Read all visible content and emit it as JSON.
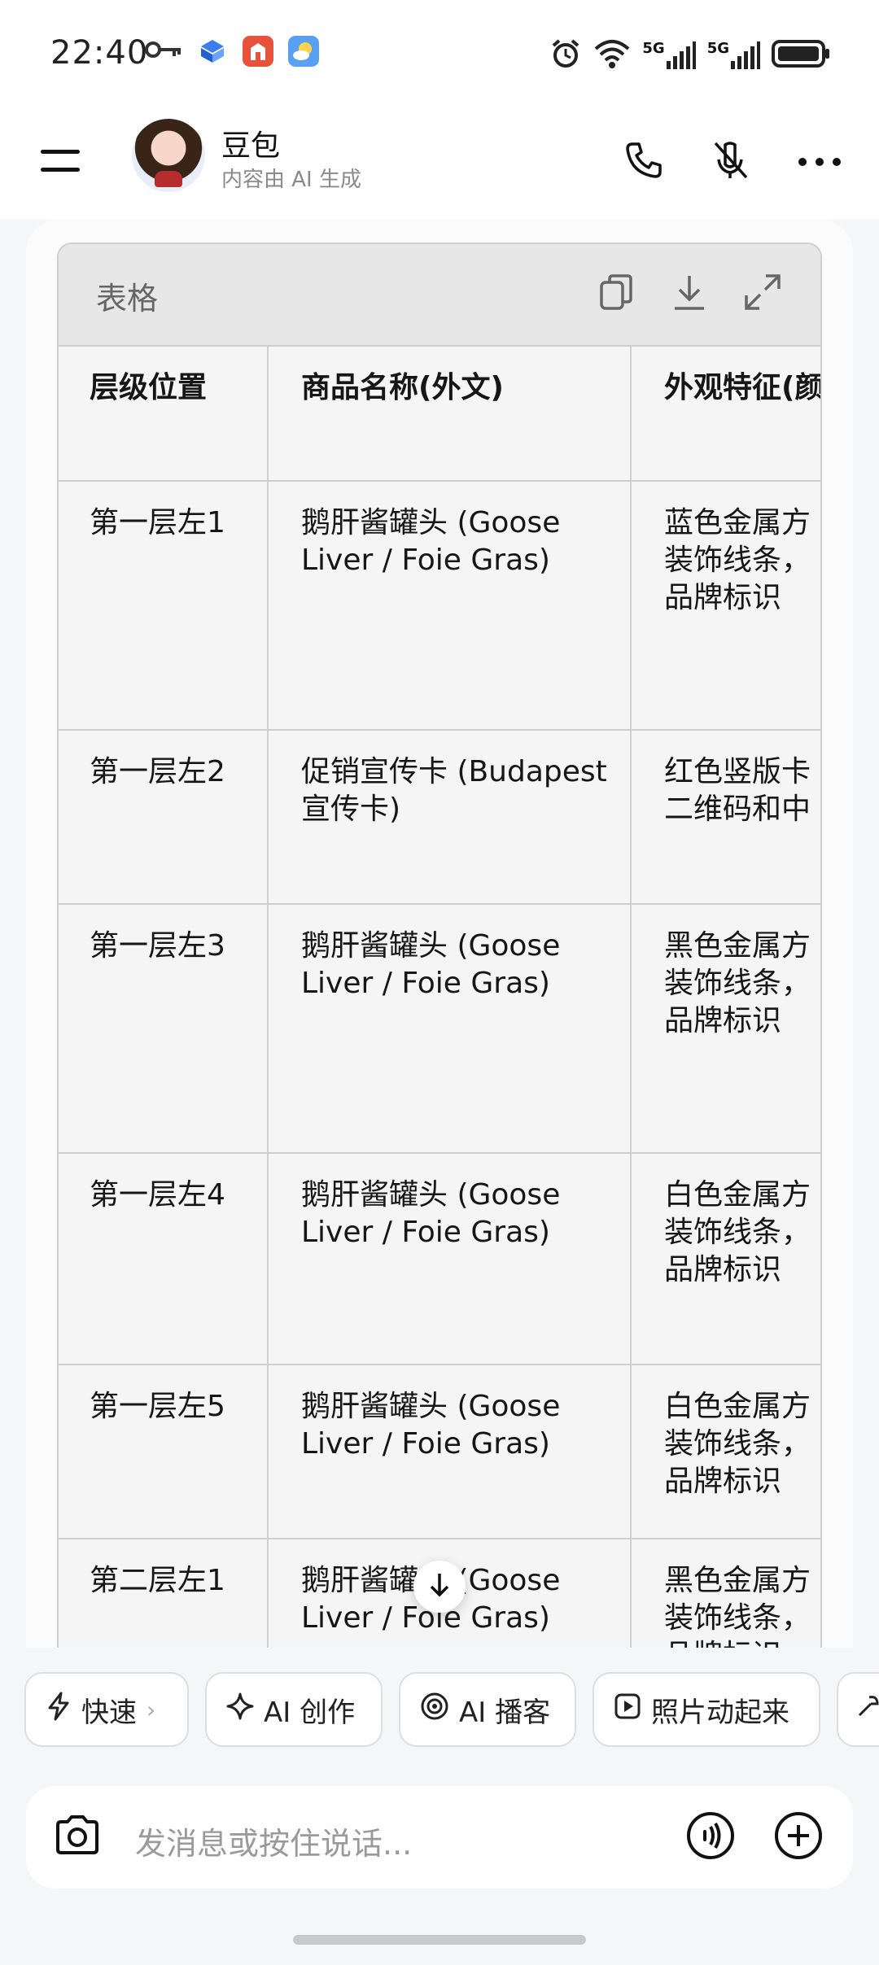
{
  "status_bar": {
    "time": "22:40",
    "network_1": "5G",
    "network_2": "5G"
  },
  "header": {
    "title": "豆包",
    "subtitle": "内容由 AI 生成"
  },
  "table": {
    "title": "表格",
    "columns": [
      "层级位置",
      "商品名称(外文)",
      "外观特征(颜"
    ],
    "rows": [
      {
        "position": "第一层左1",
        "name": "鹅肝酱罐头 (Goose Liver / Foie Gras)",
        "appearance": "蓝色金属方\n装饰线条，\n品牌标识"
      },
      {
        "position": "第一层左2",
        "name": "促销宣传卡 (Budapest 宣传卡)",
        "appearance": "红色竖版卡\n二维码和中"
      },
      {
        "position": "第一层左3",
        "name": "鹅肝酱罐头 (Goose Liver / Foie Gras)",
        "appearance": "黑色金属方\n装饰线条，\n品牌标识"
      },
      {
        "position": "第一层左4",
        "name": "鹅肝酱罐头 (Goose Liver / Foie Gras)",
        "appearance": "白色金属方\n装饰线条，\n品牌标识"
      },
      {
        "position": "第一层左5",
        "name": "鹅肝酱罐头 (Goose Liver / Foie Gras)",
        "appearance": "白色金属方\n装饰线条，\n品牌标识"
      },
      {
        "position": "第二层左1",
        "name": "鹅肝酱罐头 (Goose Liver / Foie Gras)",
        "appearance": "黑色金属方\n装饰线条，\n品牌标识"
      }
    ]
  },
  "chips": [
    "快速",
    "AI 创作",
    "AI 播客",
    "照片动起来"
  ],
  "input": {
    "placeholder": "发消息或按住说话..."
  }
}
